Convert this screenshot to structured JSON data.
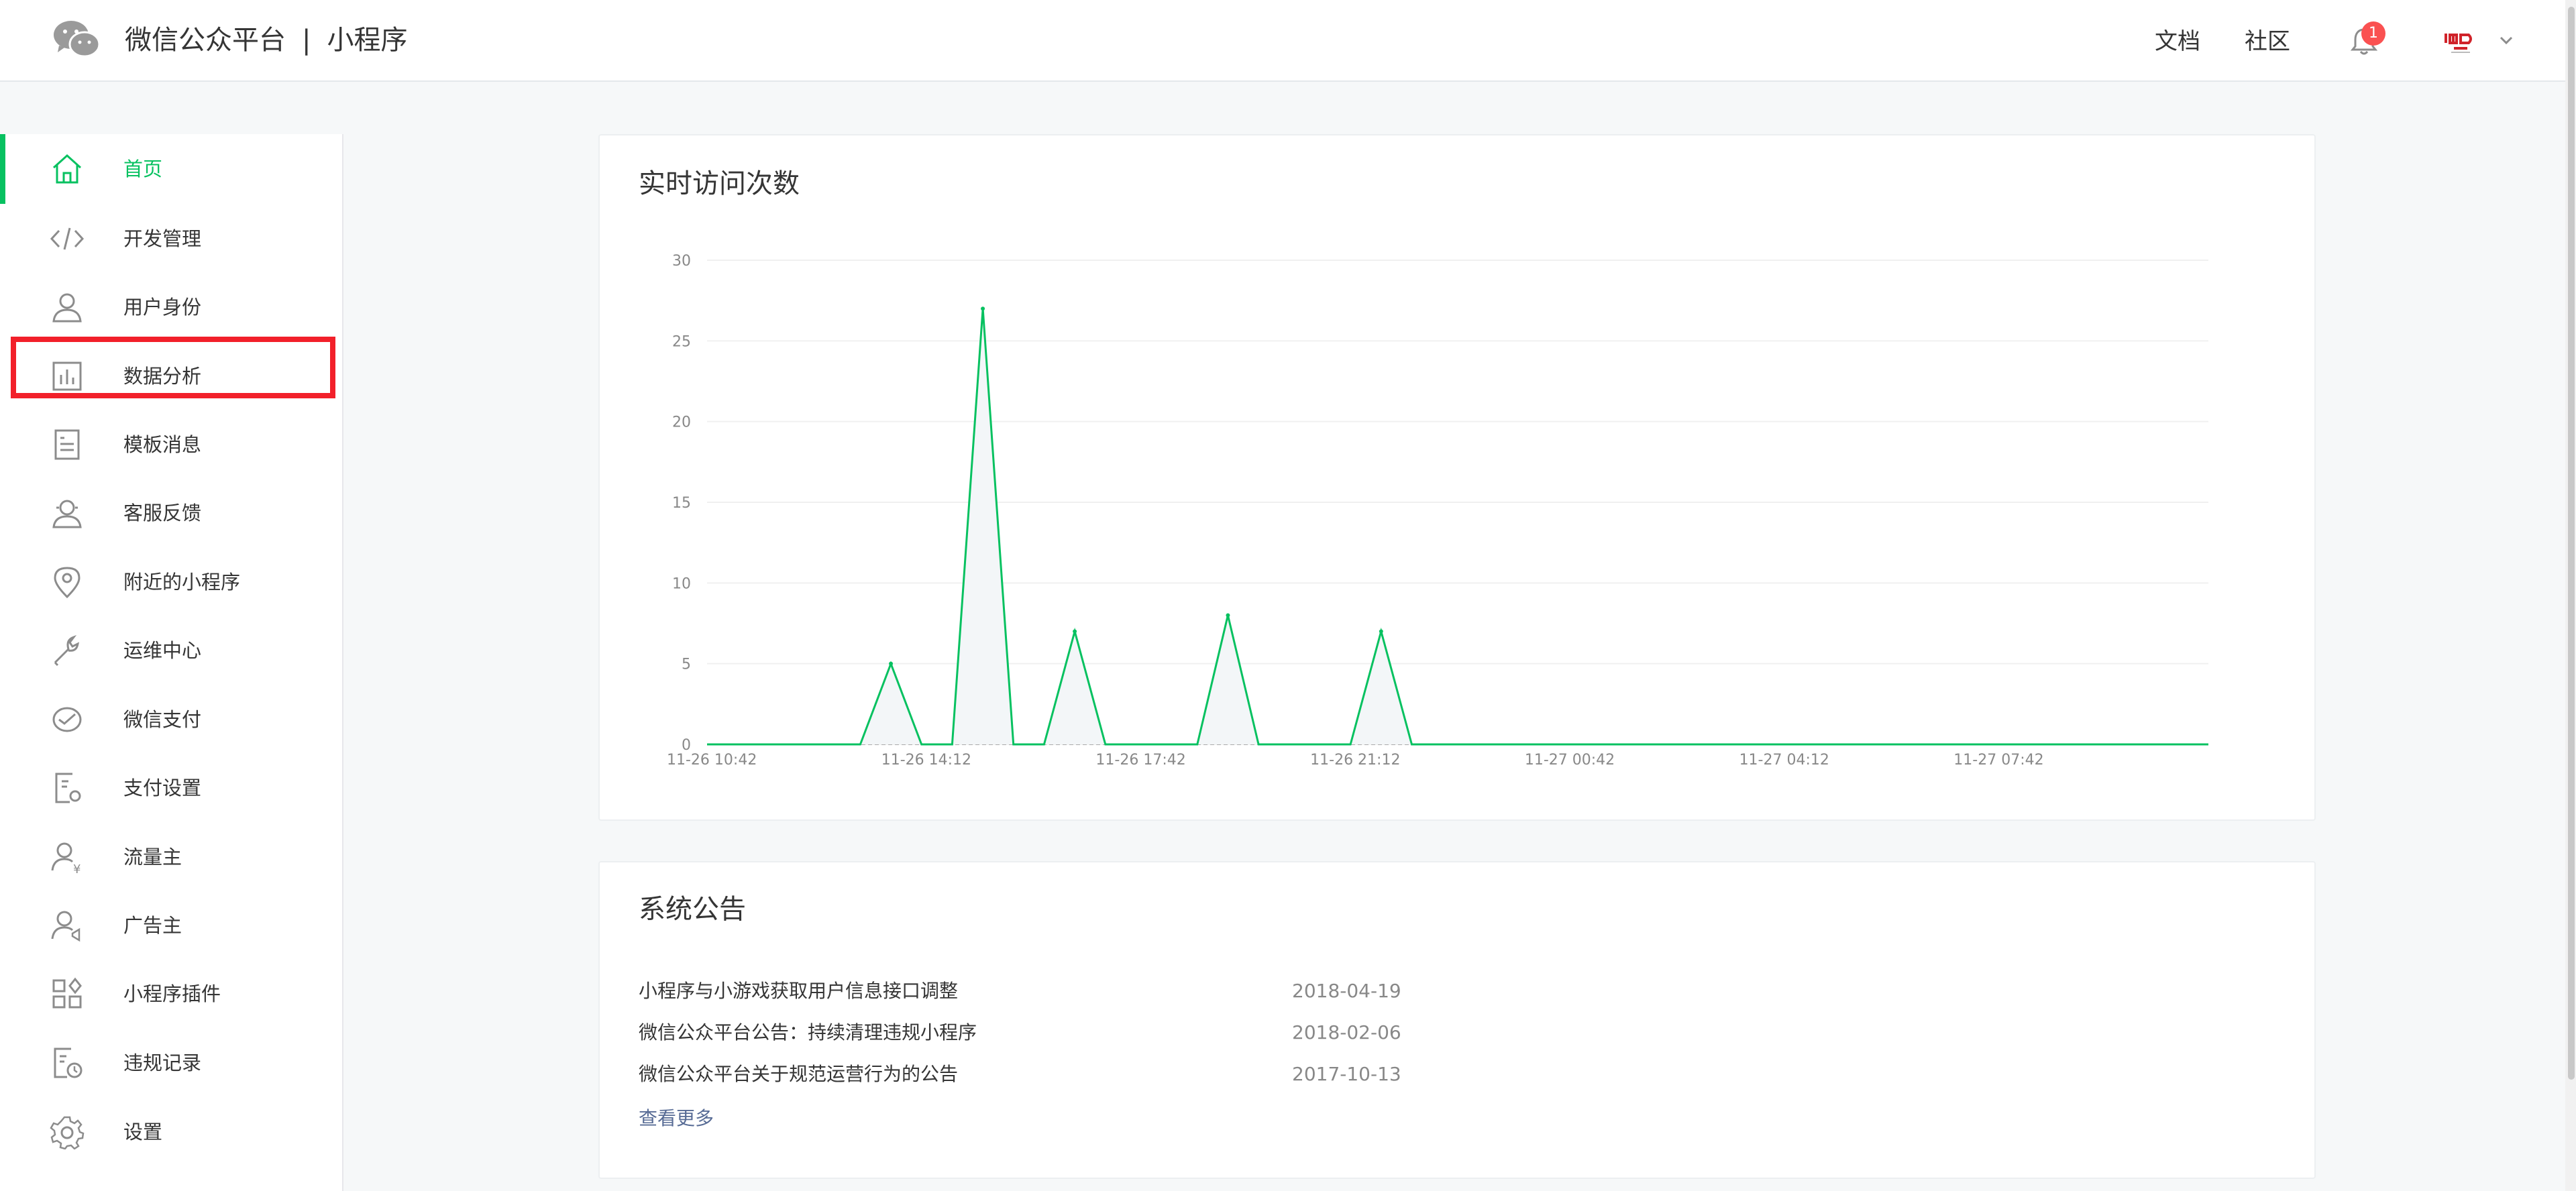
{
  "header": {
    "platform": "微信公众平台",
    "separator": "|",
    "product": "小程序",
    "docs_link": "文档",
    "community_link": "社区",
    "notification_count": "1",
    "logo_icon": "wechat-logo-icon",
    "bell_icon": "bell-icon",
    "avatar_icon": "account-avatar-icon"
  },
  "sidebar": {
    "items": [
      {
        "label": "首页",
        "icon": "home-icon",
        "active": true
      },
      {
        "label": "开发管理",
        "icon": "code-icon",
        "highlighted": true
      },
      {
        "label": "用户身份",
        "icon": "user-icon"
      },
      {
        "label": "数据分析",
        "icon": "bar-chart-icon"
      },
      {
        "label": "模板消息",
        "icon": "document-icon"
      },
      {
        "label": "客服反馈",
        "icon": "customer-service-icon"
      },
      {
        "label": "附近的小程序",
        "icon": "location-icon"
      },
      {
        "label": "运维中心",
        "icon": "wrench-icon"
      },
      {
        "label": "微信支付",
        "icon": "wechat-pay-icon"
      },
      {
        "label": "支付设置",
        "icon": "payment-settings-icon"
      },
      {
        "label": "流量主",
        "icon": "traffic-owner-icon"
      },
      {
        "label": "广告主",
        "icon": "advertiser-icon"
      },
      {
        "label": "小程序插件",
        "icon": "plugin-icon"
      },
      {
        "label": "违规记录",
        "icon": "violation-record-icon"
      },
      {
        "label": "设置",
        "icon": "gear-icon"
      }
    ]
  },
  "visits_card": {
    "title": "实时访问次数"
  },
  "chart_data": {
    "type": "area",
    "title": "实时访问次数",
    "xlabel": "",
    "ylabel": "",
    "ylim": [
      0,
      30
    ],
    "yticks": [
      0,
      5,
      10,
      15,
      20,
      25,
      30
    ],
    "xticks": [
      "11-26 10:42",
      "11-26 14:12",
      "11-26 17:42",
      "11-26 21:12",
      "11-27 00:42",
      "11-27 04:12",
      "11-27 07:42"
    ],
    "xrange_hours": [
      0,
      24.5
    ],
    "grid": true,
    "color": "#07c160",
    "points": [
      {
        "h": 0,
        "v": 0
      },
      {
        "h": 2.5,
        "v": 0
      },
      {
        "h": 3.0,
        "v": 5
      },
      {
        "h": 3.5,
        "v": 0
      },
      {
        "h": 4.0,
        "v": 0
      },
      {
        "h": 4.5,
        "v": 27
      },
      {
        "h": 5.0,
        "v": 0
      },
      {
        "h": 5.5,
        "v": 0
      },
      {
        "h": 6.0,
        "v": 7
      },
      {
        "h": 6.5,
        "v": 0
      },
      {
        "h": 8.0,
        "v": 0
      },
      {
        "h": 8.5,
        "v": 8
      },
      {
        "h": 9.0,
        "v": 0
      },
      {
        "h": 10.5,
        "v": 0
      },
      {
        "h": 11.0,
        "v": 7
      },
      {
        "h": 11.5,
        "v": 0
      },
      {
        "h": 24.5,
        "v": 0
      }
    ]
  },
  "notices_card": {
    "title": "系统公告",
    "items": [
      {
        "title": "小程序与小游戏获取用户信息接口调整",
        "date": "2018-04-19"
      },
      {
        "title": "微信公众平台公告：持续清理违规小程序",
        "date": "2018-02-06"
      },
      {
        "title": "微信公众平台关于规范运营行为的公告",
        "date": "2017-10-13"
      }
    ],
    "more": "查看更多"
  }
}
